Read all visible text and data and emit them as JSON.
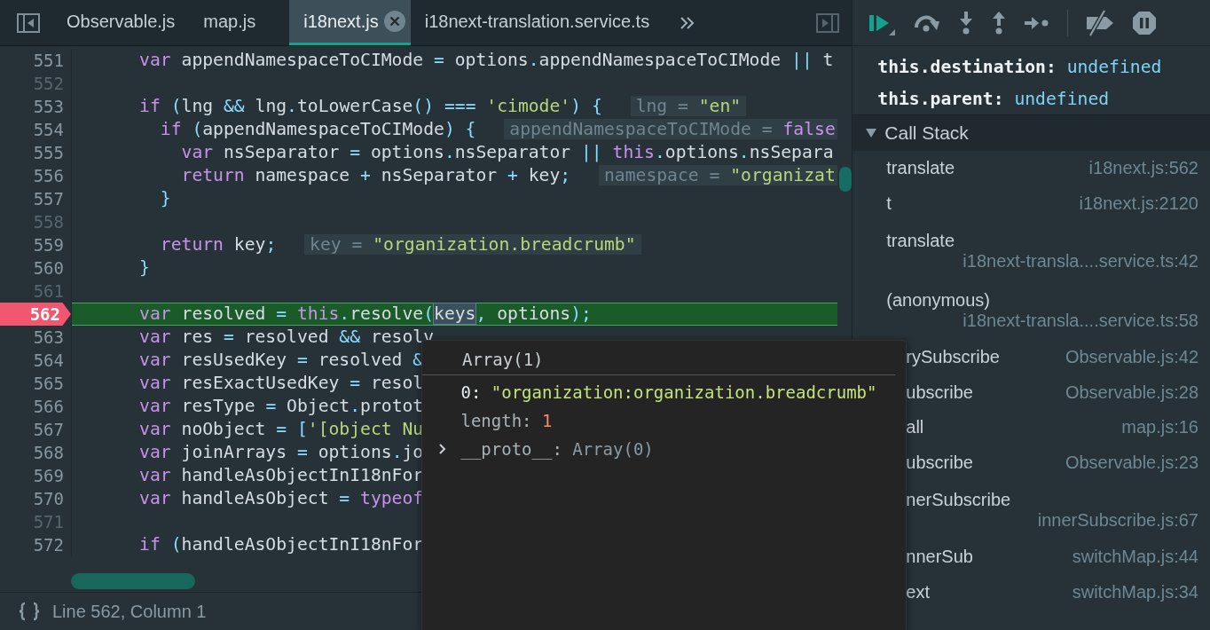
{
  "tabs": [
    {
      "label": "Observable.js",
      "selected": false
    },
    {
      "label": "map.js",
      "selected": false
    },
    {
      "label": "i18next.js",
      "selected": true
    },
    {
      "label": "i18next-translation.service.ts",
      "selected": false
    }
  ],
  "editor": {
    "lines": [
      {
        "number": "551",
        "paused": false,
        "tokens": [
          {
            "kind": "kw",
            "text": "      var"
          },
          {
            "kind": "id",
            "text": " appendNamespaceToCIMode "
          },
          {
            "kind": "op",
            "text": "="
          },
          {
            "kind": "id",
            "text": " options"
          },
          {
            "kind": "op",
            "text": "."
          },
          {
            "kind": "id",
            "text": "appendNamespaceToCIMode "
          },
          {
            "kind": "op",
            "text": "||"
          },
          {
            "kind": "id",
            "text": " t"
          }
        ]
      },
      {
        "number": "552",
        "paused": false
      },
      {
        "number": "553",
        "paused": false,
        "tokens": [
          {
            "kind": "kw",
            "text": "      if"
          },
          {
            "kind": "op",
            "text": " ("
          },
          {
            "kind": "id",
            "text": "lng "
          },
          {
            "kind": "op",
            "text": "&&"
          },
          {
            "kind": "id",
            "text": " lng"
          },
          {
            "kind": "op",
            "text": "."
          },
          {
            "kind": "id",
            "text": "toLowerCase"
          },
          {
            "kind": "op",
            "text": "()"
          },
          {
            "kind": "op",
            "text": " ==="
          },
          {
            "kind": "str",
            "text": " 'cimode'"
          },
          {
            "kind": "op",
            "text": ")"
          },
          {
            "kind": "op",
            "text": " {"
          }
        ],
        "inline_value": {
          "name": "lng =",
          "value": "\"en\"",
          "kind": "string"
        }
      },
      {
        "number": "554",
        "paused": false,
        "tokens": [
          {
            "kind": "kw",
            "text": "        if"
          },
          {
            "kind": "op",
            "text": " ("
          },
          {
            "kind": "id",
            "text": "appendNamespaceToCIMode"
          },
          {
            "kind": "op",
            "text": ")"
          },
          {
            "kind": "op",
            "text": " {"
          }
        ],
        "inline_value": {
          "name": "appendNamespaceToCIMode =",
          "value": "false",
          "kind": "boolean"
        }
      },
      {
        "number": "555",
        "paused": false,
        "tokens": [
          {
            "kind": "kw",
            "text": "          var"
          },
          {
            "kind": "id",
            "text": " nsSeparator "
          },
          {
            "kind": "op",
            "text": "="
          },
          {
            "kind": "id",
            "text": " options"
          },
          {
            "kind": "op",
            "text": "."
          },
          {
            "kind": "id",
            "text": "nsSeparator "
          },
          {
            "kind": "op",
            "text": "||"
          },
          {
            "kind": "kw",
            "text": " this"
          },
          {
            "kind": "op",
            "text": "."
          },
          {
            "kind": "id",
            "text": "options"
          },
          {
            "kind": "op",
            "text": "."
          },
          {
            "kind": "id",
            "text": "nsSepara"
          }
        ]
      },
      {
        "number": "556",
        "paused": false,
        "tokens": [
          {
            "kind": "kw",
            "text": "          return"
          },
          {
            "kind": "id",
            "text": " namespace "
          },
          {
            "kind": "op",
            "text": "+"
          },
          {
            "kind": "id",
            "text": " nsSeparator "
          },
          {
            "kind": "op",
            "text": "+"
          },
          {
            "kind": "id",
            "text": " key"
          },
          {
            "kind": "op",
            "text": ";"
          }
        ],
        "inline_value": {
          "name": "namespace =",
          "value": "\"organizat",
          "kind": "string"
        }
      },
      {
        "number": "557",
        "paused": false,
        "tokens": [
          {
            "kind": "op",
            "text": "        }"
          }
        ]
      },
      {
        "number": "558",
        "paused": false
      },
      {
        "number": "559",
        "paused": false,
        "tokens": [
          {
            "kind": "kw",
            "text": "        return"
          },
          {
            "kind": "id",
            "text": " key"
          },
          {
            "kind": "op",
            "text": ";"
          }
        ],
        "inline_value": {
          "name": "key =",
          "value": "\"organization.breadcrumb\"",
          "kind": "string"
        }
      },
      {
        "number": "560",
        "paused": false,
        "tokens": [
          {
            "kind": "op",
            "text": "      }"
          }
        ]
      },
      {
        "number": "561",
        "paused": false
      },
      {
        "number": "562",
        "paused": true,
        "tokens": [
          {
            "kind": "kw",
            "text": "      var"
          },
          {
            "kind": "id",
            "text": " resolved "
          },
          {
            "kind": "op",
            "text": "="
          },
          {
            "kind": "kw",
            "text": " this"
          },
          {
            "kind": "op",
            "text": "."
          },
          {
            "kind": "id",
            "text": "resolve"
          },
          {
            "kind": "op",
            "text": "("
          },
          {
            "kind": "hover",
            "text": "keys"
          },
          {
            "kind": "op",
            "text": ","
          },
          {
            "kind": "id",
            "text": " options"
          },
          {
            "kind": "op",
            "text": ");"
          }
        ]
      },
      {
        "number": "563",
        "paused": false,
        "tokens": [
          {
            "kind": "kw",
            "text": "      var"
          },
          {
            "kind": "id",
            "text": " res "
          },
          {
            "kind": "op",
            "text": "="
          },
          {
            "kind": "id",
            "text": " resolved "
          },
          {
            "kind": "op",
            "text": "&&"
          },
          {
            "kind": "id",
            "text": " resolv"
          }
        ]
      },
      {
        "number": "564",
        "paused": false,
        "tokens": [
          {
            "kind": "kw",
            "text": "      var"
          },
          {
            "kind": "id",
            "text": " resUsedKey "
          },
          {
            "kind": "op",
            "text": "="
          },
          {
            "kind": "id",
            "text": " resolved "
          },
          {
            "kind": "op",
            "text": "&"
          }
        ]
      },
      {
        "number": "565",
        "paused": false,
        "tokens": [
          {
            "kind": "kw",
            "text": "      var"
          },
          {
            "kind": "id",
            "text": " resExactUsedKey "
          },
          {
            "kind": "op",
            "text": "="
          },
          {
            "kind": "id",
            "text": " resol"
          }
        ]
      },
      {
        "number": "566",
        "paused": false,
        "tokens": [
          {
            "kind": "kw",
            "text": "      var"
          },
          {
            "kind": "id",
            "text": " resType "
          },
          {
            "kind": "op",
            "text": "="
          },
          {
            "kind": "id",
            "text": " Object"
          },
          {
            "kind": "op",
            "text": "."
          },
          {
            "kind": "id",
            "text": "protot"
          }
        ]
      },
      {
        "number": "567",
        "paused": false,
        "tokens": [
          {
            "kind": "kw",
            "text": "      var"
          },
          {
            "kind": "id",
            "text": " noObject "
          },
          {
            "kind": "op",
            "text": "="
          },
          {
            "kind": "op",
            "text": " ["
          },
          {
            "kind": "str",
            "text": "'[object Nu"
          }
        ]
      },
      {
        "number": "568",
        "paused": false,
        "tokens": [
          {
            "kind": "kw",
            "text": "      var"
          },
          {
            "kind": "id",
            "text": " joinArrays "
          },
          {
            "kind": "op",
            "text": "="
          },
          {
            "kind": "id",
            "text": " options"
          },
          {
            "kind": "op",
            "text": "."
          },
          {
            "kind": "id",
            "text": "jo"
          }
        ]
      },
      {
        "number": "569",
        "paused": false,
        "tokens": [
          {
            "kind": "kw",
            "text": "      var"
          },
          {
            "kind": "id",
            "text": " handleAsObjectInI18nFor"
          }
        ]
      },
      {
        "number": "570",
        "paused": false,
        "tokens": [
          {
            "kind": "kw",
            "text": "      var"
          },
          {
            "kind": "id",
            "text": " handleAsObject "
          },
          {
            "kind": "op",
            "text": "="
          },
          {
            "kind": "kw",
            "text": " typeof"
          }
        ]
      },
      {
        "number": "571",
        "paused": false
      },
      {
        "number": "572",
        "paused": false,
        "tokens": [
          {
            "kind": "kw",
            "text": "      if"
          },
          {
            "kind": "op",
            "text": " ("
          },
          {
            "kind": "id",
            "text": "handleAsObjectInI18nFor"
          }
        ]
      }
    ]
  },
  "status_bar": {
    "position": "Line 562, Column 1"
  },
  "popup": {
    "title": "Array(1)",
    "properties": [
      {
        "key": "0:",
        "value": "\"organization:organization.breadcrumb\"",
        "kind": "string",
        "enumerable": true,
        "expandable": false
      },
      {
        "key": "length:",
        "value": "1",
        "kind": "number",
        "enumerable": false,
        "expandable": false
      },
      {
        "key": "__proto__:",
        "value": "Array(0)",
        "kind": "object",
        "enumerable": false,
        "expandable": true
      }
    ]
  },
  "watch": [
    {
      "expression": "this.destination:",
      "value": "undefined"
    },
    {
      "expression": "this.parent:",
      "value": "undefined"
    }
  ],
  "call_stack": {
    "title": "Call Stack",
    "expanded": true,
    "frames": [
      {
        "name": "translate",
        "location": "i18next.js:562",
        "wrap": false,
        "covered": false
      },
      {
        "name": "t",
        "location": "i18next.js:2120",
        "wrap": false,
        "covered": false
      },
      {
        "name": "translate",
        "location": "i18next-transla....service.ts:42",
        "wrap": true,
        "covered": false
      },
      {
        "name": "(anonymous)",
        "location": "i18next-transla....service.ts:58",
        "wrap": true,
        "covered": false
      },
      {
        "name": "rySubscribe",
        "location": "Observable.js:42",
        "wrap": false,
        "covered": true
      },
      {
        "name": "ubscribe",
        "location": "Observable.js:28",
        "wrap": false,
        "covered": true
      },
      {
        "name": "all",
        "location": "map.js:16",
        "wrap": false,
        "covered": true
      },
      {
        "name": "ubscribe",
        "location": "Observable.js:23",
        "wrap": false,
        "covered": true
      },
      {
        "name": "nerSubscribe",
        "location": "innerSubscribe.js:67",
        "wrap": true,
        "covered": true
      },
      {
        "name": "nnerSub",
        "location": "switchMap.js:44",
        "wrap": false,
        "covered": true
      },
      {
        "name": "ext",
        "location": "switchMap.js:34",
        "wrap": false,
        "covered": true
      }
    ]
  }
}
